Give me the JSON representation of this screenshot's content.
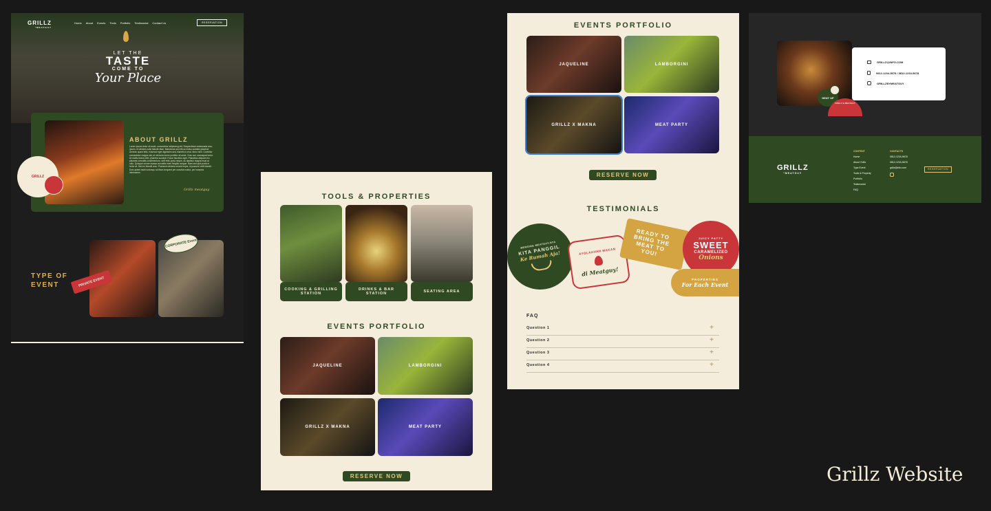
{
  "caption": "Grillz Website",
  "home": {
    "logo": "GRILLZ",
    "logo_sub": "*MEATGUY",
    "nav": [
      "Home",
      "About",
      "Events",
      "Tools",
      "Portfolio",
      "Testimonial",
      "Contact Us"
    ],
    "reservation_label": "RESERVATION",
    "hero_line1": "LET THE",
    "hero_line2": "TASTE",
    "hero_line3": "COME TO",
    "hero_line4": "Your Place",
    "about_title": "ABOUT GRILLZ",
    "about_body": "Lorem ipsum dolor sit amet, consectetur adipiscing elit. Suspendisse malesuada arcu ipsum, id ultricies nulla blandit vitae. Maecenas sed elit ac lectus sodales placerat. Aenean quam felis, euismod eget dignissim sed, blandit ut urna. Nunc nibh. Curabitur consectetur magna nisl, at vehicula lorem porttitor sit amet. Cras non consequat tortor. Ut mollis lectus nibh, pharetra suscipit. Fusce faucibus eget. Phasellus aliquam leo placerat convallis condimentum, sem felis porta neque, ac dapibus magna risus at odio. Quisque ornare massa convallis enim fringilla congue. Nam sed quis porta in tortor at. Sed eu blandit arcu. Praesent ultricies ornare turpis, id posuere velit blandit. Duis aptent taciti sociosqu ad litora torquent per conubia nostra, per inceptos himenaeos.",
    "about_signature": "Grillz meatguy",
    "badge_grillz": "GRILLZ",
    "type_title_1": "TYPE OF",
    "type_title_2": "EVENT",
    "private_event": "PRIVATE EVENT",
    "corporate_event": "CORPORATE Event"
  },
  "tools": {
    "title": "TOOLS & PROPERTIES",
    "items": [
      "COOKING & GRILLING STATION",
      "DRINKS & BAR STATION",
      "SEATING AREA"
    ],
    "portfolio_title": "EVENTS PORTFOLIO",
    "portfolio": [
      "JAQUELINE",
      "LAMBORGINI",
      "GRILLZ X MAKNA",
      "MEAT PARTY"
    ],
    "reserve_label": "RESERVE NOW"
  },
  "events": {
    "portfolio_title": "EVENTS PORTFOLIO",
    "portfolio": [
      "JAQUELINE",
      "LAMBORGINI",
      "GRILLZ X MAKNA",
      "MEAT PARTY"
    ],
    "reserve_label": "RESERVE NOW",
    "testimonials_title": "TESTIMONIALS",
    "stickers": {
      "kita_top": "MENGING MEATGUY.NYA",
      "kita_1": "KITA PANGGIL",
      "kita_2": "Ke Rumah Aja!",
      "ayo_1": "AYOLAAHHH MAKAN",
      "ayo_2": "di Meatguy!",
      "ready": "READY TO BRING THE MEAT TO YOU!",
      "juicy": "JUICY PATTY",
      "sweet": "SWEET",
      "caramelized": "CARAMELIZED",
      "onions": "Onions",
      "properties": "PROPERTIES",
      "for_each": "For Each Event"
    },
    "faq_title": "FAQ",
    "faq": [
      "Question 1",
      "Question 2",
      "Question 3",
      "Question 4"
    ]
  },
  "contact": {
    "email": "GRILLZ@INFO.COM",
    "phone": "0812-1234-5678 / 0812-1234-5678",
    "instagram": "GRILLZBYMEATGUY",
    "badge_text": "HEAT UP",
    "arc_text": "GRILLZ & MEATGUY"
  },
  "footer": {
    "logo": "GRILLZ",
    "logo_sub": "*MEATGUY",
    "content_title": "CONTENT",
    "content_links": [
      "Home",
      "About Grillz",
      "Type Event",
      "Tools & Property",
      "Portfolio",
      "Testimonial",
      "FAQ"
    ],
    "contacts_title": "CONTACTS",
    "contacts": [
      "0812-1234-5678",
      "0812-1234-5678",
      "grillz@info.com"
    ],
    "reservation_label": "RESERVATION"
  },
  "colors": {
    "bg": "#181818",
    "green": "#2f4a22",
    "cream": "#f5eddc",
    "gold": "#e8c77a",
    "red": "#c8363a"
  }
}
